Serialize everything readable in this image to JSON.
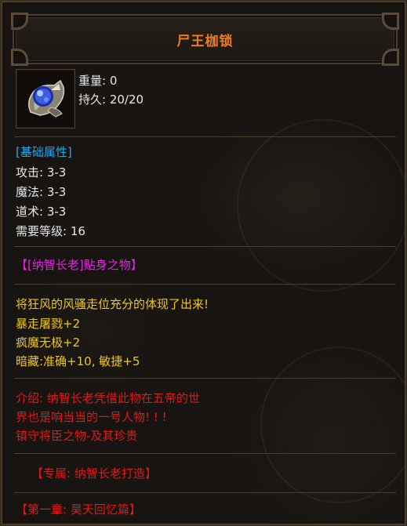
{
  "item": {
    "name": "尸王枷锁",
    "icon": "blue-gem-ring-icon",
    "weight": "重量: 0",
    "durability": "持久: 20/20"
  },
  "base_attrs": {
    "header": "[基础属性]",
    "attack": "攻击: 3-3",
    "magic": "魔法: 3-3",
    "tao": "道术: 3-3",
    "level_req": "需要等级: 16"
  },
  "set_tag": "【[纳智长老]贴身之物】",
  "bonus": {
    "line1": "将狂风的风骚走位充分的体现了出来!",
    "line2": "暴走屠戮+2",
    "line3": "疯魔无极+2",
    "line4": "暗藏:准确+10, 敏捷+5"
  },
  "intro": {
    "line1": "介绍: 纳智长老凭借此物在五帝的世",
    "line2": "界也是响当当的一号人物! ! !",
    "line3": "镇守将臣之物-及其珍贵"
  },
  "exclusive": "【专属: 纳智长老打造】",
  "chapter": "【第一章: 昊天回忆篇】",
  "colors": {
    "title": "#f07a1a",
    "header": "#1ea8f0",
    "set_tag": "#e226e0",
    "bonus": "#f0c818",
    "intro": "#e01818"
  }
}
